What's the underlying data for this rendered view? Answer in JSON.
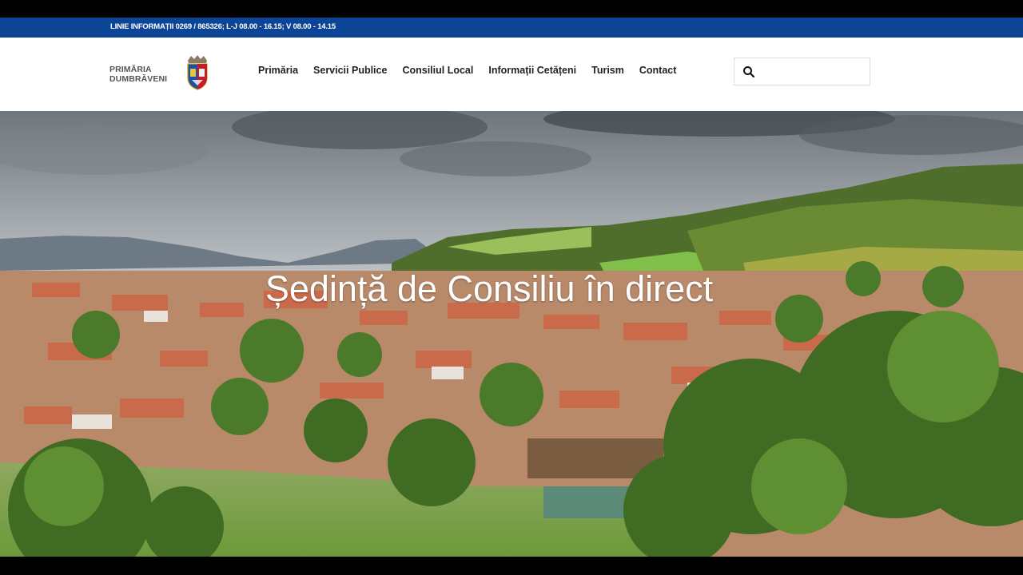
{
  "info_bar": {
    "text": "LINIE INFORMAȚII 0269 / 865326; L-J 08.00 - 16.15; V 08.00 - 14.15"
  },
  "brand": {
    "line1": "PRIMĂRIA",
    "line2": "DUMBRĂVENI",
    "crest_icon": "town-crest-icon"
  },
  "nav": {
    "items": [
      {
        "label": "Primăria"
      },
      {
        "label": "Servicii Publice"
      },
      {
        "label": "Consiliul Local"
      },
      {
        "label": "Informații Cetățeni"
      },
      {
        "label": "Turism"
      },
      {
        "label": "Contact"
      }
    ]
  },
  "search": {
    "placeholder": "",
    "value": "",
    "icon": "search-icon"
  },
  "hero": {
    "title": "Ședință de Consiliu în direct",
    "image": "village-landscape-photo"
  },
  "colors": {
    "info_bar": "#0c4595",
    "header_bg": "#ffffff",
    "nav_text": "#222222"
  }
}
